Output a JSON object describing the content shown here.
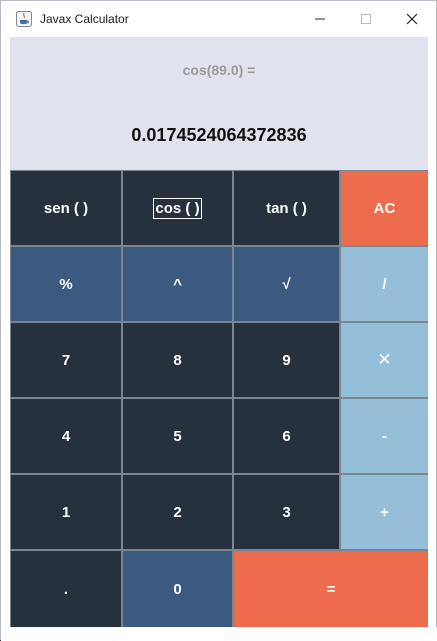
{
  "window": {
    "title": "Javax Calculator",
    "minimize_glyph": "—",
    "maximize_glyph": "☐",
    "close_glyph": "✕"
  },
  "display": {
    "expression": "cos(89.0) =",
    "result": "0.0174524064372836"
  },
  "buttons": {
    "sen": "sen ( )",
    "cos": "cos ( )",
    "tan": "tan ( )",
    "ac": "AC",
    "percent": "%",
    "power": "^",
    "sqrt": "√",
    "divide": "/",
    "seven": "7",
    "eight": "8",
    "nine": "9",
    "multiply": "✕",
    "four": "4",
    "five": "5",
    "six": "6",
    "minus": "-",
    "one": "1",
    "two": "2",
    "three": "3",
    "plus": "+",
    "dot": ".",
    "zero": "0",
    "equals": "="
  },
  "colors": {
    "dark": "#27303d",
    "blue": "#3c5a80",
    "light_blue": "#95bfd8",
    "orange": "#ed6c4d",
    "display_bg": "#e0e3ee"
  }
}
